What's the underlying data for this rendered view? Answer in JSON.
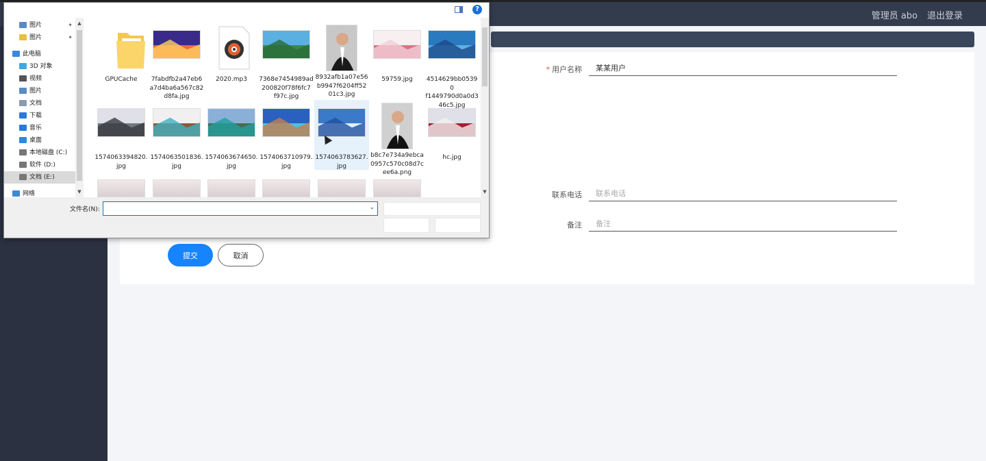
{
  "header": {
    "user": "管理员 abo",
    "logout": "退出登录"
  },
  "form": {
    "username_label": "用户名称",
    "username_required": "*",
    "username_value": "某某用户",
    "phone_label": "联系电话",
    "phone_placeholder": "联系电话",
    "remark_label": "备注",
    "remark_placeholder": "备注",
    "submit": "提交",
    "cancel": "取消"
  },
  "dialog": {
    "help": "?",
    "filename_label": "文件名(N):",
    "filename_value": "",
    "nav": [
      {
        "label": "图片",
        "icon": "pictures-icon",
        "pinned": true
      },
      {
        "label": "图片",
        "icon": "folder-icon",
        "pinned": true
      },
      {
        "label": "此电脑",
        "icon": "computer-icon"
      },
      {
        "label": "3D 对象",
        "icon": "3d-objects-icon"
      },
      {
        "label": "视频",
        "icon": "video-icon"
      },
      {
        "label": "图片",
        "icon": "pictures-icon"
      },
      {
        "label": "文档",
        "icon": "documents-icon"
      },
      {
        "label": "下载",
        "icon": "download-icon"
      },
      {
        "label": "音乐",
        "icon": "music-icon"
      },
      {
        "label": "桌面",
        "icon": "desktop-icon"
      },
      {
        "label": "本地磁盘 (C:)",
        "icon": "drive-icon"
      },
      {
        "label": "软件 (D:)",
        "icon": "drive-icon"
      },
      {
        "label": "文档 (E:)",
        "icon": "drive-icon",
        "active": true
      },
      {
        "label": "网络",
        "icon": "network-icon"
      }
    ],
    "files": [
      {
        "name": "GPUCache",
        "kind": "folder"
      },
      {
        "name": "7fabdfb2a47eb6a7d4ba6a567c82d8fa.jpg",
        "kind": "image",
        "colors": [
          "#3a2a8a",
          "#f06a3a",
          "#ffd060"
        ]
      },
      {
        "name": "2020.mp3",
        "kind": "audio"
      },
      {
        "name": "7368e7454989ad200820f78f6fc7f97c.jpg",
        "kind": "image",
        "colors": [
          "#5ab0e0",
          "#3a8a4a",
          "#2a6a3a"
        ]
      },
      {
        "name": "8932afb1a07e56b9947f6204ff5201c3.jpg",
        "kind": "portrait",
        "colors": [
          "#c8c8c8",
          "#1a1a1a",
          "#2a2a2a"
        ]
      },
      {
        "name": "59759.jpg",
        "kind": "image",
        "colors": [
          "#f8f0f0",
          "#e07080",
          "#f0d0d8"
        ]
      },
      {
        "name": "4514629bb05390f1449790d0a0d346c5.jpg",
        "kind": "image",
        "colors": [
          "#2a7ac0",
          "#60b0e0",
          "#1a4a8a"
        ]
      },
      {
        "name": "1574063394820.jpg",
        "kind": "image",
        "colors": [
          "#e0e0e8",
          "#707880",
          "#3a3a40"
        ]
      },
      {
        "name": "1574063501836.jpg",
        "kind": "image",
        "colors": [
          "#f0f0f0",
          "#8a5a3a",
          "#40b0c0"
        ]
      },
      {
        "name": "1574063674650.jpg",
        "kind": "image",
        "colors": [
          "#8ab0d8",
          "#4a6a4a",
          "#20a0a0"
        ]
      },
      {
        "name": "1574063710979.jpg",
        "kind": "image",
        "colors": [
          "#2a60c0",
          "#50c0e0",
          "#c08050"
        ]
      },
      {
        "name": "1574063783627.jpg",
        "kind": "image",
        "colors": [
          "#3a7ac8",
          "#e0f0ff",
          "#2050a0"
        ],
        "selected": true
      },
      {
        "name": "b8c7e734a9ebca0957c570c08d7cee6a.png",
        "kind": "portrait",
        "colors": [
          "#d0d0d0",
          "#111111",
          "#303030"
        ]
      },
      {
        "name": "hc.jpg",
        "kind": "image",
        "colors": [
          "#e0e0e8",
          "#a02030",
          "#f0f0f0"
        ]
      }
    ]
  }
}
